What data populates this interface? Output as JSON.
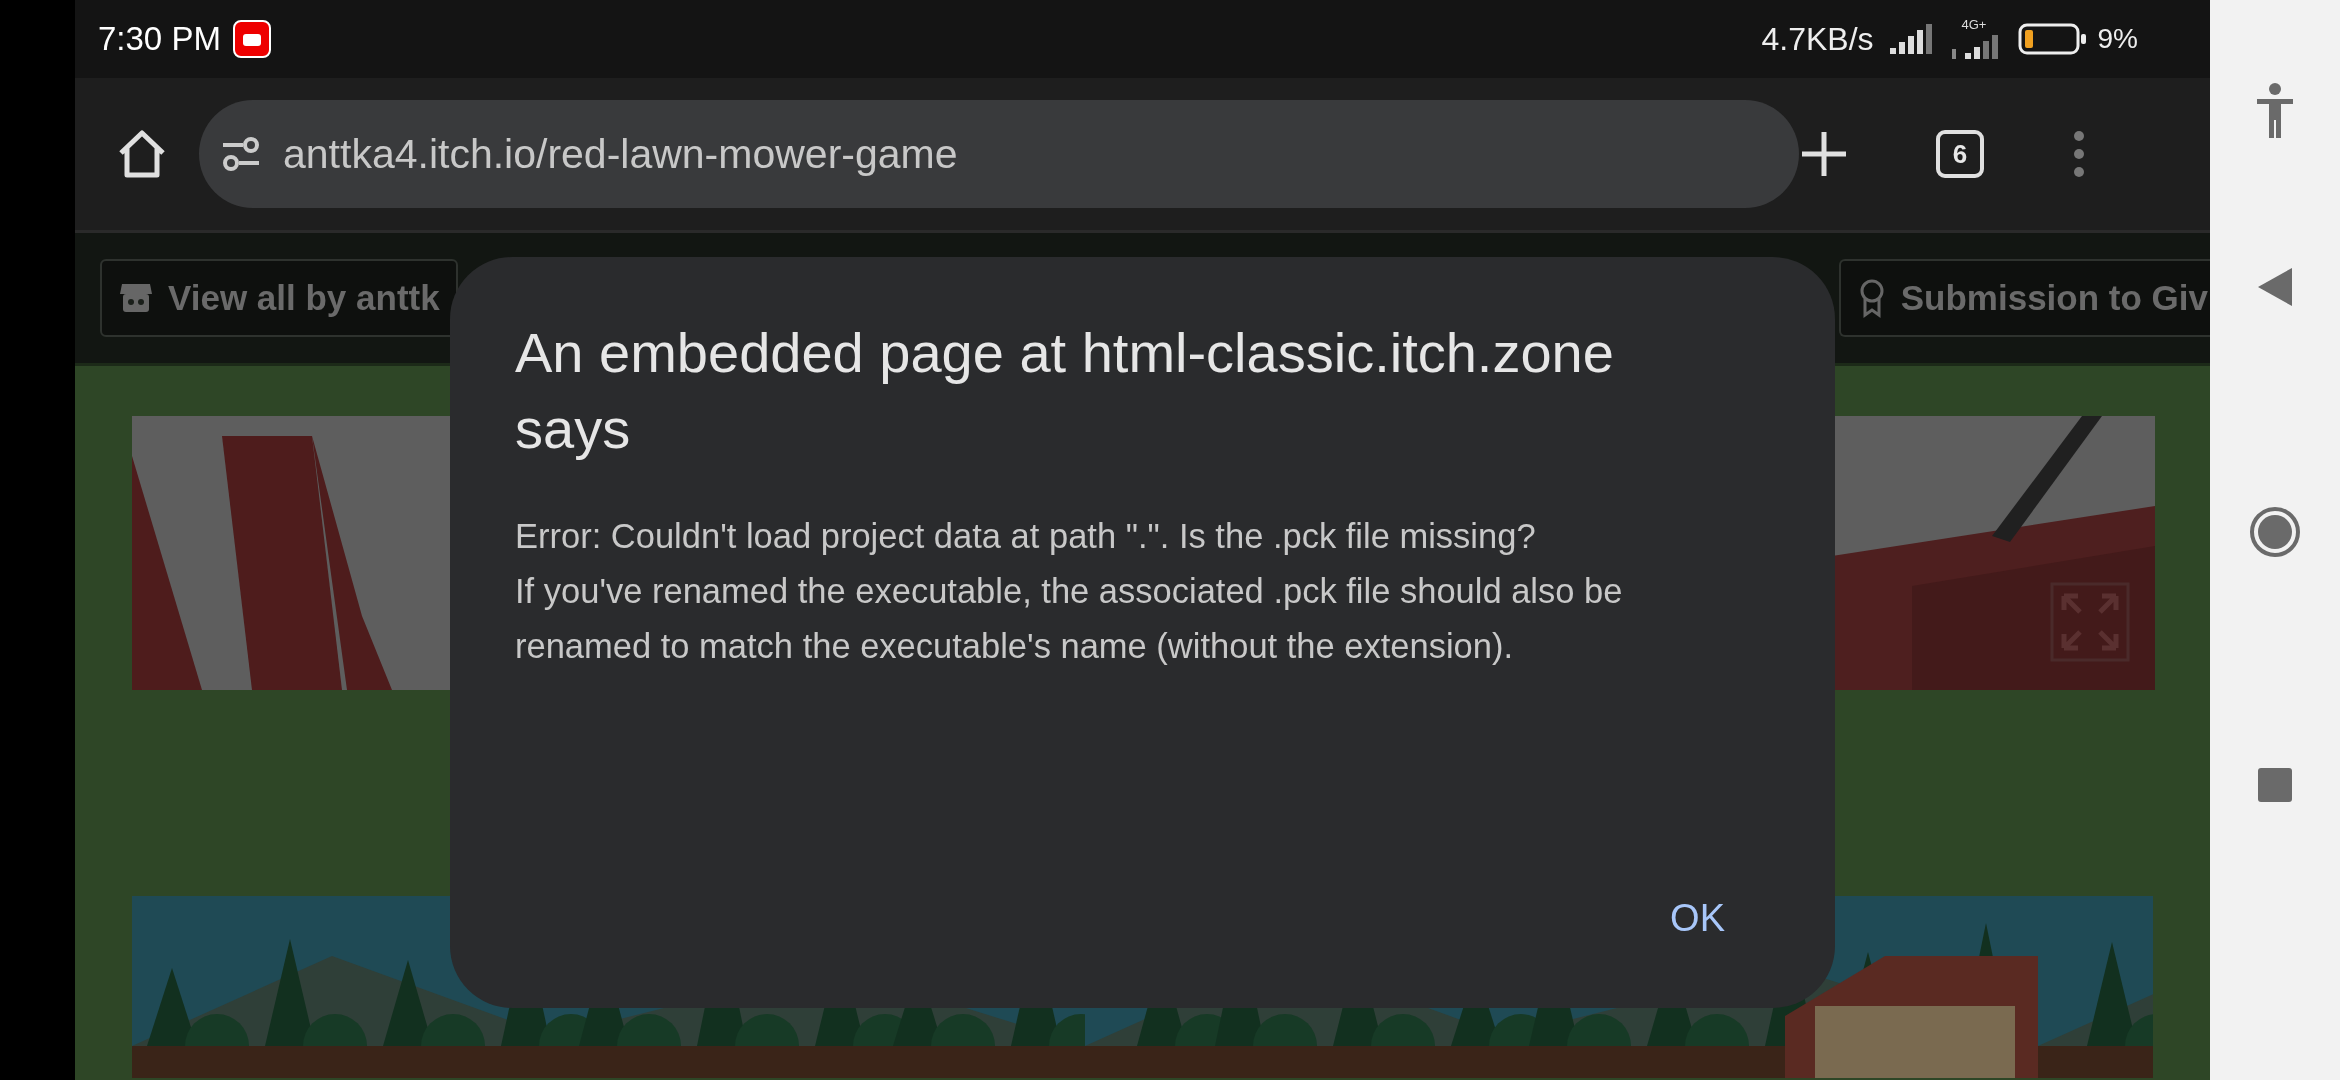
{
  "status_bar": {
    "time": "7:30 PM",
    "net_speed": "4.7KB/s",
    "network_type": "4G+",
    "battery": "9%"
  },
  "browser": {
    "url": "anttka4.itch.io/red-lawn-mower-game",
    "tab_count": "6"
  },
  "page": {
    "header_buttons": [
      {
        "kind": "creator",
        "label": "View all by anttk"
      },
      {
        "kind": "jam",
        "label": "Submission to Giv"
      }
    ]
  },
  "dialog": {
    "title": "An embedded page at html-classic.itch.zone says",
    "message_lines": [
      "Error: Couldn't load project data at path \".\". Is the .pck file missing?",
      "If you've renamed the executable, the associated .pck file should also be",
      "renamed to match the executable's name (without the extension)."
    ],
    "button": "OK"
  }
}
